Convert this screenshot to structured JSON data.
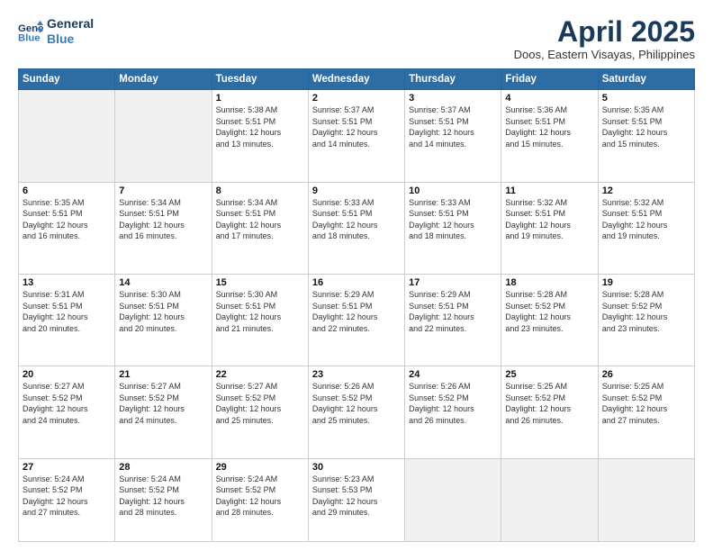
{
  "header": {
    "logo_line1": "General",
    "logo_line2": "Blue",
    "title": "April 2025",
    "subtitle": "Doos, Eastern Visayas, Philippines"
  },
  "calendar": {
    "days_of_week": [
      "Sunday",
      "Monday",
      "Tuesday",
      "Wednesday",
      "Thursday",
      "Friday",
      "Saturday"
    ],
    "weeks": [
      [
        {
          "day": "",
          "empty": true
        },
        {
          "day": "",
          "empty": true
        },
        {
          "day": "1",
          "sunrise": "5:38 AM",
          "sunset": "5:51 PM",
          "daylight": "12 hours and 13 minutes."
        },
        {
          "day": "2",
          "sunrise": "5:37 AM",
          "sunset": "5:51 PM",
          "daylight": "12 hours and 14 minutes."
        },
        {
          "day": "3",
          "sunrise": "5:37 AM",
          "sunset": "5:51 PM",
          "daylight": "12 hours and 14 minutes."
        },
        {
          "day": "4",
          "sunrise": "5:36 AM",
          "sunset": "5:51 PM",
          "daylight": "12 hours and 15 minutes."
        },
        {
          "day": "5",
          "sunrise": "5:35 AM",
          "sunset": "5:51 PM",
          "daylight": "12 hours and 15 minutes."
        }
      ],
      [
        {
          "day": "6",
          "sunrise": "5:35 AM",
          "sunset": "5:51 PM",
          "daylight": "12 hours and 16 minutes."
        },
        {
          "day": "7",
          "sunrise": "5:34 AM",
          "sunset": "5:51 PM",
          "daylight": "12 hours and 16 minutes."
        },
        {
          "day": "8",
          "sunrise": "5:34 AM",
          "sunset": "5:51 PM",
          "daylight": "12 hours and 17 minutes."
        },
        {
          "day": "9",
          "sunrise": "5:33 AM",
          "sunset": "5:51 PM",
          "daylight": "12 hours and 18 minutes."
        },
        {
          "day": "10",
          "sunrise": "5:33 AM",
          "sunset": "5:51 PM",
          "daylight": "12 hours and 18 minutes."
        },
        {
          "day": "11",
          "sunrise": "5:32 AM",
          "sunset": "5:51 PM",
          "daylight": "12 hours and 19 minutes."
        },
        {
          "day": "12",
          "sunrise": "5:32 AM",
          "sunset": "5:51 PM",
          "daylight": "12 hours and 19 minutes."
        }
      ],
      [
        {
          "day": "13",
          "sunrise": "5:31 AM",
          "sunset": "5:51 PM",
          "daylight": "12 hours and 20 minutes."
        },
        {
          "day": "14",
          "sunrise": "5:30 AM",
          "sunset": "5:51 PM",
          "daylight": "12 hours and 20 minutes."
        },
        {
          "day": "15",
          "sunrise": "5:30 AM",
          "sunset": "5:51 PM",
          "daylight": "12 hours and 21 minutes."
        },
        {
          "day": "16",
          "sunrise": "5:29 AM",
          "sunset": "5:51 PM",
          "daylight": "12 hours and 22 minutes."
        },
        {
          "day": "17",
          "sunrise": "5:29 AM",
          "sunset": "5:51 PM",
          "daylight": "12 hours and 22 minutes."
        },
        {
          "day": "18",
          "sunrise": "5:28 AM",
          "sunset": "5:52 PM",
          "daylight": "12 hours and 23 minutes."
        },
        {
          "day": "19",
          "sunrise": "5:28 AM",
          "sunset": "5:52 PM",
          "daylight": "12 hours and 23 minutes."
        }
      ],
      [
        {
          "day": "20",
          "sunrise": "5:27 AM",
          "sunset": "5:52 PM",
          "daylight": "12 hours and 24 minutes."
        },
        {
          "day": "21",
          "sunrise": "5:27 AM",
          "sunset": "5:52 PM",
          "daylight": "12 hours and 24 minutes."
        },
        {
          "day": "22",
          "sunrise": "5:27 AM",
          "sunset": "5:52 PM",
          "daylight": "12 hours and 25 minutes."
        },
        {
          "day": "23",
          "sunrise": "5:26 AM",
          "sunset": "5:52 PM",
          "daylight": "12 hours and 25 minutes."
        },
        {
          "day": "24",
          "sunrise": "5:26 AM",
          "sunset": "5:52 PM",
          "daylight": "12 hours and 26 minutes."
        },
        {
          "day": "25",
          "sunrise": "5:25 AM",
          "sunset": "5:52 PM",
          "daylight": "12 hours and 26 minutes."
        },
        {
          "day": "26",
          "sunrise": "5:25 AM",
          "sunset": "5:52 PM",
          "daylight": "12 hours and 27 minutes."
        }
      ],
      [
        {
          "day": "27",
          "sunrise": "5:24 AM",
          "sunset": "5:52 PM",
          "daylight": "12 hours and 27 minutes."
        },
        {
          "day": "28",
          "sunrise": "5:24 AM",
          "sunset": "5:52 PM",
          "daylight": "12 hours and 28 minutes."
        },
        {
          "day": "29",
          "sunrise": "5:24 AM",
          "sunset": "5:52 PM",
          "daylight": "12 hours and 28 minutes."
        },
        {
          "day": "30",
          "sunrise": "5:23 AM",
          "sunset": "5:53 PM",
          "daylight": "12 hours and 29 minutes."
        },
        {
          "day": "",
          "empty": true
        },
        {
          "day": "",
          "empty": true
        },
        {
          "day": "",
          "empty": true
        }
      ]
    ]
  },
  "labels": {
    "sunrise": "Sunrise:",
    "sunset": "Sunset:",
    "daylight": "Daylight:"
  }
}
